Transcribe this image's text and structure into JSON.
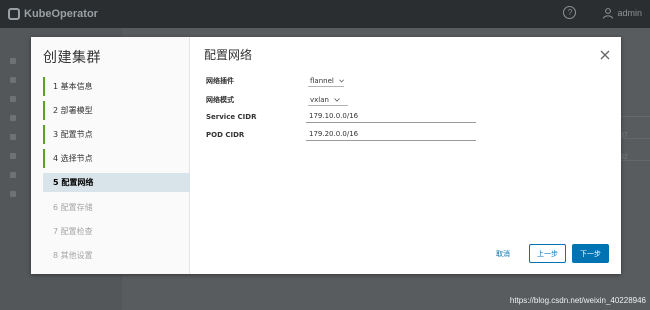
{
  "header": {
    "app_name": "KubeOperator",
    "help_glyph": "?",
    "user": "admin"
  },
  "background": {
    "values": [
      "37",
      "32"
    ]
  },
  "wizard": {
    "title": "创建集群",
    "steps": [
      {
        "label": "1 基本信息",
        "state": "done"
      },
      {
        "label": "2 部署模型",
        "state": "done"
      },
      {
        "label": "3 配置节点",
        "state": "done"
      },
      {
        "label": "4 选择节点",
        "state": "done"
      },
      {
        "label": "5 配置网络",
        "state": "active"
      },
      {
        "label": "6 配置存储",
        "state": "disabled"
      },
      {
        "label": "7 配置检查",
        "state": "disabled"
      },
      {
        "label": "8 其他设置",
        "state": "disabled"
      }
    ]
  },
  "page": {
    "title": "配置网络",
    "fields": {
      "plugin_label": "网络插件",
      "plugin_value": "flannel",
      "mode_label": "网络模式",
      "mode_value": "vxlan",
      "service_cidr_label": "Service CIDR",
      "service_cidr_value": "179.10.0.0/16",
      "pod_cidr_label": "POD CIDR",
      "pod_cidr_value": "179.20.0.0/16"
    }
  },
  "buttons": {
    "cancel": "取消",
    "prev": "上一步",
    "next": "下一步"
  },
  "watermark": "https://blog.csdn.net/weixin_40228946",
  "colors": {
    "accent": "#0073b2",
    "step_done": "#5aa220",
    "step_active_bg": "#d9e4ea"
  }
}
